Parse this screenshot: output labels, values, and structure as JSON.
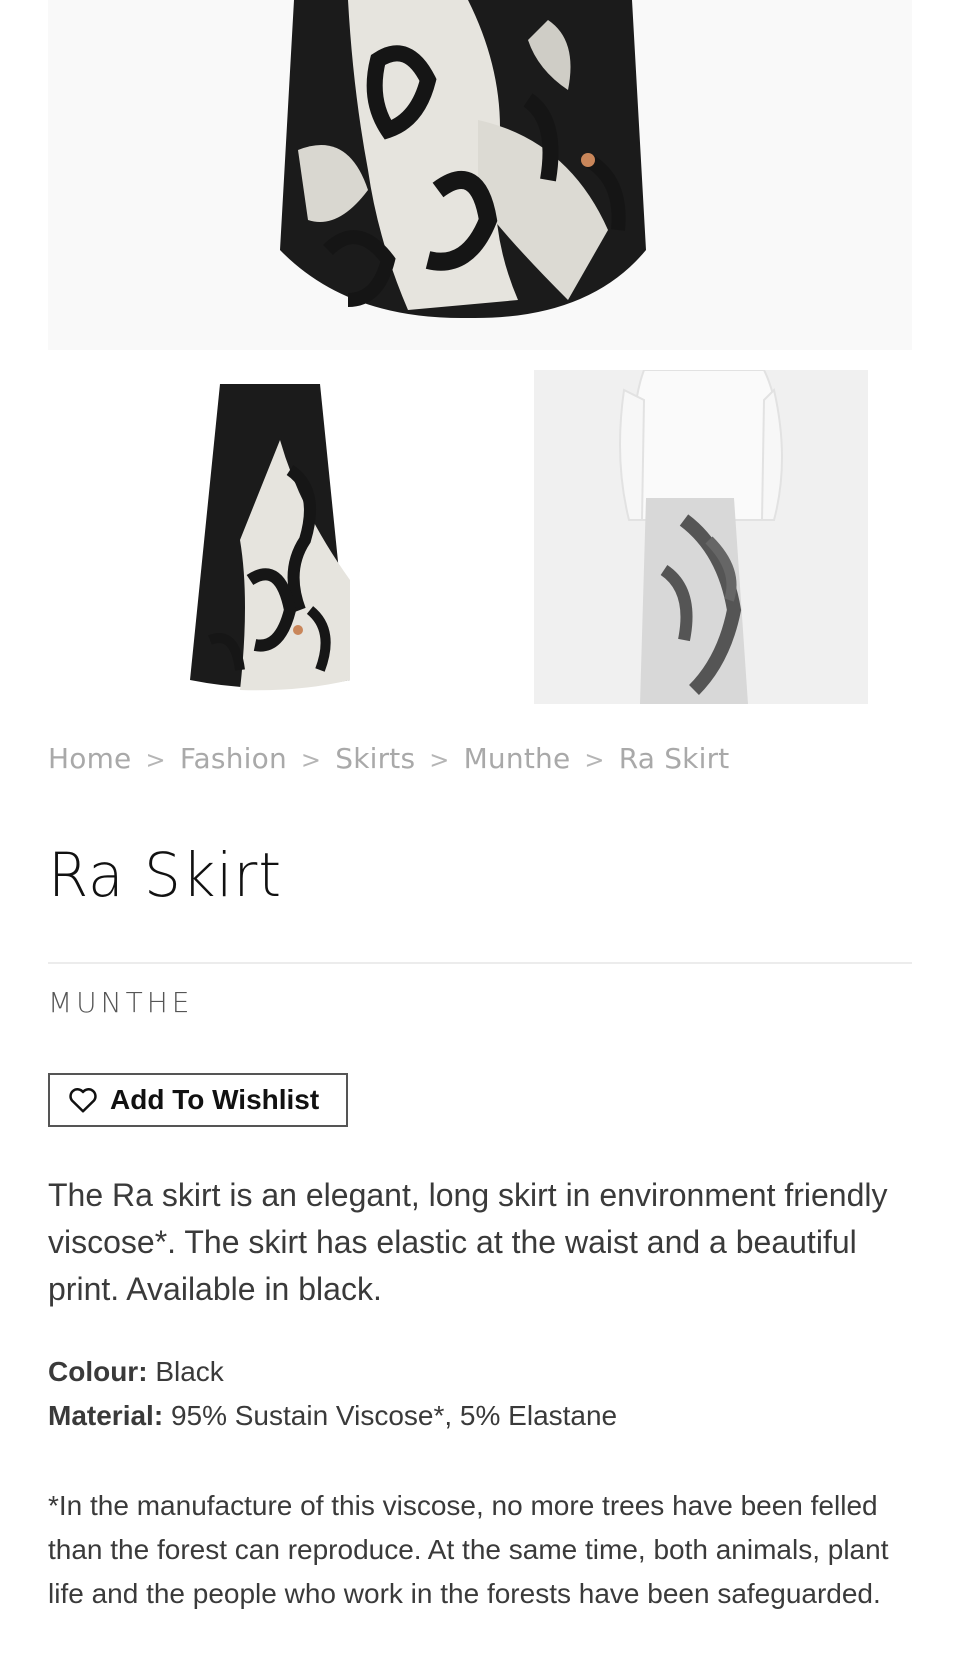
{
  "breadcrumb": {
    "items": [
      "Home",
      "Fashion",
      "Skirts",
      "Munthe",
      "Ra Skirt"
    ],
    "separator": ">"
  },
  "product": {
    "title": "Ra Skirt",
    "brand": "MUNTHE",
    "wishlist_label": "Add To Wishlist",
    "description": "The Ra skirt is an elegant, long skirt in environment friendly viscose*. The skirt has elastic at the waist and a beautiful print. Available in black.",
    "colour_label": "Colour:",
    "colour_value": "Black",
    "material_label": "Material:",
    "material_value": "95% Sustain Viscose*, 5% Elastane",
    "footnote": "*In the manufacture of this viscose, no more trees have been felled than the forest can reproduce. At the same time, both animals, plant life and the people who work in the forests have been safeguarded."
  },
  "icons": {
    "wishlist": "heart-outline-icon"
  },
  "colors": {
    "text": "#3a3a3a",
    "breadcrumb": "#a9a9a9",
    "skirt_black": "#1a1a1a",
    "print_cream": "#e8e6e0"
  }
}
